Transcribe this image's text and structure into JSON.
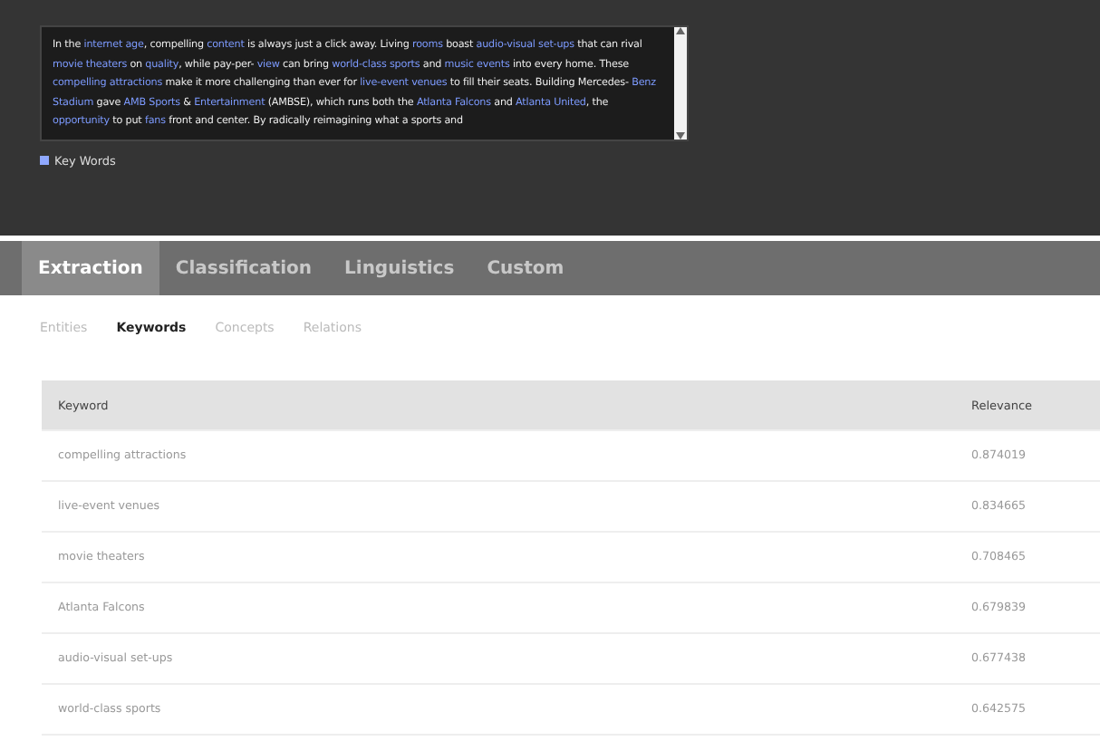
{
  "article": {
    "segments": [
      {
        "text": "In the ",
        "highlight": false
      },
      {
        "text": "internet age",
        "highlight": true
      },
      {
        "text": ", compelling ",
        "highlight": false
      },
      {
        "text": "content",
        "highlight": true
      },
      {
        "text": " is always just a click away. Living ",
        "highlight": false
      },
      {
        "text": "rooms",
        "highlight": true
      },
      {
        "text": " boast ",
        "highlight": false
      },
      {
        "text": "audio-visual set-ups",
        "highlight": true
      },
      {
        "text": " that can rival ",
        "highlight": false
      },
      {
        "text": "movie theaters",
        "highlight": true
      },
      {
        "text": " on ",
        "highlight": false
      },
      {
        "text": "quality",
        "highlight": true
      },
      {
        "text": ", while pay-per- ",
        "highlight": false
      },
      {
        "text": "view",
        "highlight": true
      },
      {
        "text": " can bring ",
        "highlight": false
      },
      {
        "text": "world-class sports",
        "highlight": true
      },
      {
        "text": " and ",
        "highlight": false
      },
      {
        "text": "music events",
        "highlight": true
      },
      {
        "text": " into every home. These ",
        "highlight": false
      },
      {
        "text": "compelling attractions",
        "highlight": true
      },
      {
        "text": " make it more challenging than ever for ",
        "highlight": false
      },
      {
        "text": "live-event venues",
        "highlight": true
      },
      {
        "text": " to fill their seats. Building Mercedes- ",
        "highlight": false
      },
      {
        "text": "Benz Stadium",
        "highlight": true
      },
      {
        "text": " gave ",
        "highlight": false
      },
      {
        "text": "AMB Sports",
        "highlight": true
      },
      {
        "text": " & ",
        "highlight": false
      },
      {
        "text": "Entertainment",
        "highlight": true
      },
      {
        "text": " (AMBSE), which runs both the ",
        "highlight": false
      },
      {
        "text": "Atlanta Falcons",
        "highlight": true
      },
      {
        "text": " and ",
        "highlight": false
      },
      {
        "text": "Atlanta United",
        "highlight": true
      },
      {
        "text": ", the ",
        "highlight": false
      },
      {
        "text": "opportunity",
        "highlight": true
      },
      {
        "text": " to put ",
        "highlight": false
      },
      {
        "text": "fans",
        "highlight": true
      },
      {
        "text": " front and center. By radically reimagining what a sports and",
        "highlight": false
      }
    ]
  },
  "legend": {
    "label": "Key Words"
  },
  "tabs": [
    {
      "label": "Extraction",
      "selected": true
    },
    {
      "label": "Classification",
      "selected": false
    },
    {
      "label": "Linguistics",
      "selected": false
    },
    {
      "label": "Custom",
      "selected": false
    }
  ],
  "subtabs": [
    {
      "label": "Entities",
      "selected": false
    },
    {
      "label": "Keywords",
      "selected": true
    },
    {
      "label": "Concepts",
      "selected": false
    },
    {
      "label": "Relations",
      "selected": false
    }
  ],
  "table": {
    "columns": [
      "Keyword",
      "Relevance"
    ],
    "rows": [
      [
        "compelling attractions",
        "0.874019"
      ],
      [
        "live-event venues",
        "0.834665"
      ],
      [
        "movie theaters",
        "0.708465"
      ],
      [
        "Atlanta Falcons",
        "0.679839"
      ],
      [
        "audio-visual set-ups",
        "0.677438"
      ],
      [
        "world-class sports",
        "0.642575"
      ]
    ]
  }
}
